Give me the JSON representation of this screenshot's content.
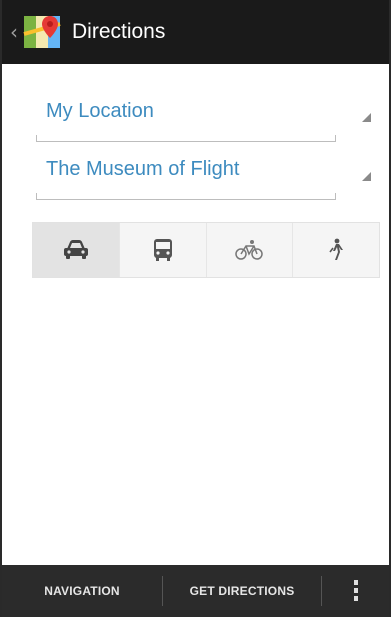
{
  "action_bar": {
    "title": "Directions",
    "up_icon": "chevron-left-icon",
    "app_icon": "maps-app-icon"
  },
  "route": {
    "start": {
      "value": "My Location"
    },
    "destination": {
      "value": "The Museum of Flight"
    }
  },
  "travel_modes": [
    {
      "name": "car",
      "icon": "car-icon",
      "selected": true
    },
    {
      "name": "transit",
      "icon": "bus-icon",
      "selected": false
    },
    {
      "name": "bicycle",
      "icon": "bicycle-icon",
      "selected": false
    },
    {
      "name": "walk",
      "icon": "walking-icon",
      "selected": false
    }
  ],
  "bottom_bar": {
    "navigation_label": "NAVIGATION",
    "get_directions_label": "GET DIRECTIONS",
    "overflow_icon": "more-vertical-icon"
  },
  "colors": {
    "accent_text": "#3d8bbf",
    "action_bar": "#1a1a1a",
    "bottom_bar": "#2b2b2b"
  }
}
